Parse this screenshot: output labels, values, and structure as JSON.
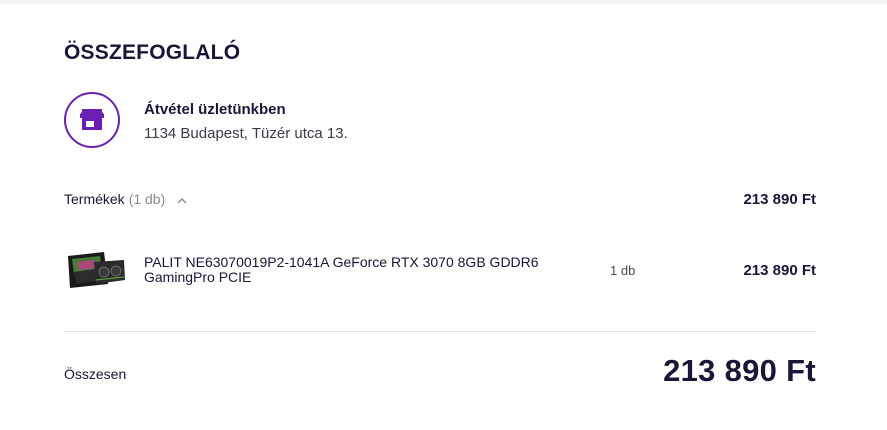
{
  "summary": {
    "title": "ÖSSZEFOGLALÓ",
    "accent_color": "#6b1fb1",
    "pickup": {
      "icon": "store-icon",
      "title": "Átvétel üzletünkben",
      "address": "1134 Budapest, Tüzér utca 13."
    },
    "products": {
      "label": "Termékek",
      "count": "(1 db)",
      "toggle_icon": "chevron-up-icon",
      "total": "213 890 Ft",
      "items": [
        {
          "name": "PALIT NE63070019P2-1041A GeForce RTX 3070 8GB GDDR6 GamingPro PCIE",
          "quantity": "1 db",
          "price": "213 890 Ft",
          "thumbnail": "graphics-card-image"
        }
      ]
    },
    "grand_total": {
      "label": "Összesen",
      "value": "213 890 Ft"
    }
  }
}
